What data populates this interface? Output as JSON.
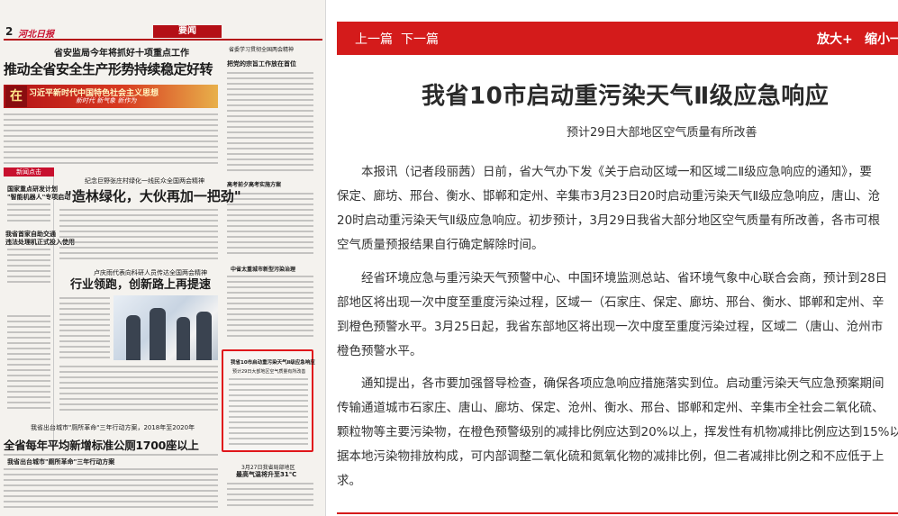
{
  "newspaper": {
    "page_number": "2",
    "masthead": "河北日报",
    "section_tag": "要闻",
    "headline_kicker": "省安监局今年将抓好十项重点工作",
    "headline_main": "推动全省安全生产形势持续稳定好转",
    "banner_line1": "习近平新时代中国特色社会主义思想",
    "banner_line2": "新时代 新气象 新作为",
    "banner_seal": "在",
    "sidebar_head": "新闻点击",
    "side_t1": "国家重点研发计划",
    "side_t2": "\"智能机器人\"专项启动",
    "side_t3": "我省首家自助交通",
    "side_t4": "违法处理机正式投入使用",
    "side_t5": "我省出台城市\"厕所革命\"三年行动方案",
    "side_t6": "",
    "mid_kicker1": "纪念巨野张庄村绿化一线民众全国两会精神",
    "mid_hl1": "\"造林绿化，大伙再加一把劲\"",
    "mid_kicker2": "卢庆雨代表向科研人员传达全国两会精神",
    "mid_hl2": "行业领跑，创新路上再提速",
    "bottom_kicker": "我省出台城市\"厕所革命\"三年行动方案，2018年至2020年",
    "bottom_hl": "全省每年平均新增标准公厕1700座以上",
    "right_col_hl1": "省委学习贯彻全国两会精神",
    "right_col_hl2": "把党的宗旨工作放在首位",
    "right_col_hl3": "高考前夕高考实施方案",
    "right_col_hl4": "中省太重城市新型污染治理",
    "bottom_right_hl1": "3月27日我省局部地区",
    "bottom_right_hl2": "最高气温将升至31℃",
    "highlight_title": "我省10市启动重污染天气Ⅱ级应急响应",
    "highlight_sub": "预计29日大部地区空气质量有所改善"
  },
  "toolbar": {
    "prev": "上一篇",
    "next": "下一篇",
    "zoom_in": "放大+",
    "zoom_out": "缩小一"
  },
  "article": {
    "title": "我省10市启动重污染天气Ⅱ级应急响应",
    "subtitle": "预计29日大部地区空气质量有所改善",
    "lines": [
      "　　本报讯（记者段丽茜）日前，省大气办下发《关于启动区域一和区域二Ⅱ级应急响应的通知》，要",
      "保定、廊坊、邢台、衡水、邯郸和定州、辛集市3月23日20时启动重污染天气Ⅱ级应急响应，唐山、沧",
      "20时启动重污染天气Ⅱ级应急响应。初步预计，3月29日我省大部分地区空气质量有所改善，各市可根",
      "空气质量预报结果自行确定解除时间。",
      "　　经省环境应急与重污染天气预警中心、中国环境监测总站、省环境气象中心联合会商，预计到28日",
      "部地区将出现一次中度至重度污染过程，区域一（石家庄、保定、廊坊、邢台、衡水、邯郸和定州、辛",
      "到橙色预警水平。3月25日起，我省东部地区将出现一次中度至重度污染过程，区域二（唐山、沧州市",
      "橙色预警水平。",
      "　　通知提出，各市要加强督导检查，确保各项应急响应措施落实到位。启动重污染天气应急预案期间",
      "传输通道城市石家庄、唐山、廊坊、保定、沧州、衡水、邢台、邯郸和定州、辛集市全社会二氧化硫、",
      "颗粒物等主要污染物，在橙色预警级别的减排比例应达到20%以上，挥发性有机物减排比例应达到15%以",
      "据本地污染物排放构成，可内部调整二氧化硫和氮氧化物的减排比例，但二者减排比例之和不应低于上",
      "求。"
    ]
  },
  "colors": {
    "accent": "#d41b1b",
    "highlight_border": "#e0161b"
  }
}
